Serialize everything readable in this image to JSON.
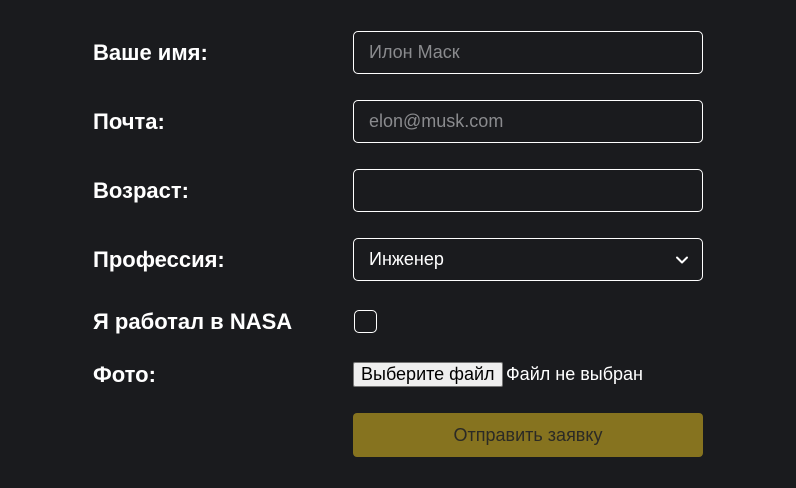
{
  "form": {
    "name": {
      "label": "Ваше имя:",
      "placeholder": "Илон Маск",
      "value": ""
    },
    "email": {
      "label": "Почта:",
      "placeholder": "elon@musk.com",
      "value": ""
    },
    "age": {
      "label": "Возраст:",
      "placeholder": "",
      "value": ""
    },
    "profession": {
      "label": "Профессия:",
      "selected": "Инженер"
    },
    "nasa": {
      "label": "Я работал в NASA",
      "checked": false
    },
    "photo": {
      "label": "Фото:",
      "button_label": "Выберите файл",
      "status": "Файл не выбран"
    },
    "submit_label": "Отправить заявку"
  },
  "colors": {
    "background": "#1a1b1e",
    "text": "#ffffff",
    "placeholder": "#8a8b8e",
    "submit_bg": "#86731f",
    "submit_text": "#2b2a25"
  },
  "icons": {
    "select_indicator": "chevron-down-icon"
  }
}
